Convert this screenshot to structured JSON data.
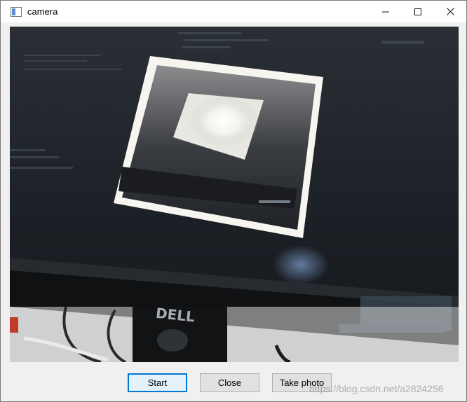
{
  "window": {
    "title": "camera",
    "icon": "window-icon",
    "controls": {
      "minimize": "minimize-icon",
      "maximize": "maximize-icon",
      "close": "close-icon"
    }
  },
  "video": {
    "brand_text": "DELL"
  },
  "buttons": {
    "start": "Start",
    "close": "Close",
    "take_photo": "Take photo"
  },
  "watermark": "https://blog.csdn.net/a2824256",
  "colors": {
    "accent": "#0078d7",
    "button_bg": "#e1e1e1",
    "window_bg": "#f0f0f0"
  }
}
